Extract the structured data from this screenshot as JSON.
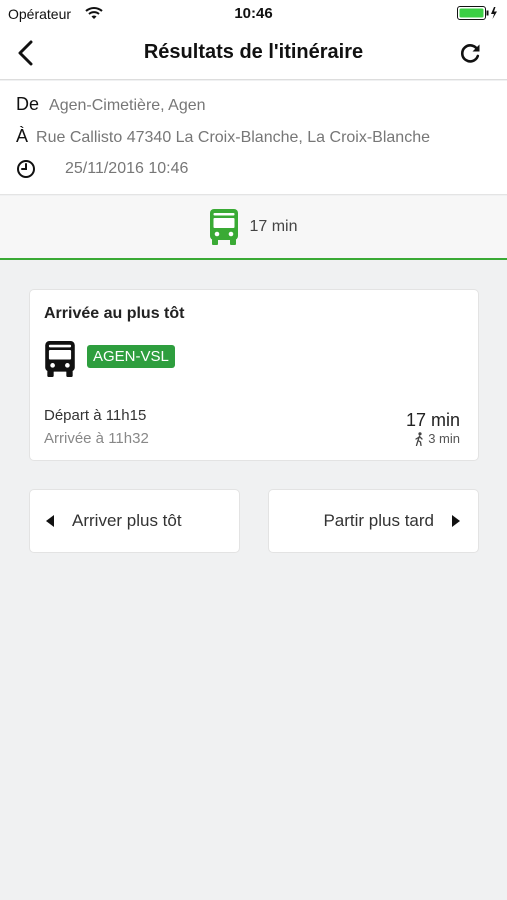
{
  "status_bar": {
    "carrier": "Opérateur",
    "time": "10:46",
    "icons": [
      "wifi-icon",
      "battery-icon"
    ]
  },
  "nav": {
    "title": "Résultats de l'itinéraire",
    "icons": [
      "chevron-left-icon",
      "refresh-icon"
    ]
  },
  "route": {
    "from_label": "De",
    "from_value": "Agen-Cimetière, Agen",
    "to_label": "À",
    "to_value": "Rue Callisto 47340 La Croix-Blanche, La Croix-Blanche",
    "datetime": "25/11/2016 10:46",
    "icons": [
      "clock-icon"
    ]
  },
  "mode_tab": {
    "duration": "17 min",
    "icon": "bus-icon",
    "accent_color": "#3aaa35"
  },
  "result": {
    "heading": "Arrivée au plus tôt",
    "line": "AGEN-VSL",
    "line_color": "#2e9e3e",
    "departure": "Départ à 11h15",
    "arrival": "Arrivée à 11h32",
    "duration": "17 min",
    "walk_duration": "3 min",
    "icons": [
      "bus-icon",
      "walk-icon"
    ]
  },
  "actions": {
    "earlier_label": "Arriver plus tôt",
    "later_label": "Partir plus tard",
    "icons": [
      "triangle-left-icon",
      "triangle-right-icon"
    ]
  }
}
